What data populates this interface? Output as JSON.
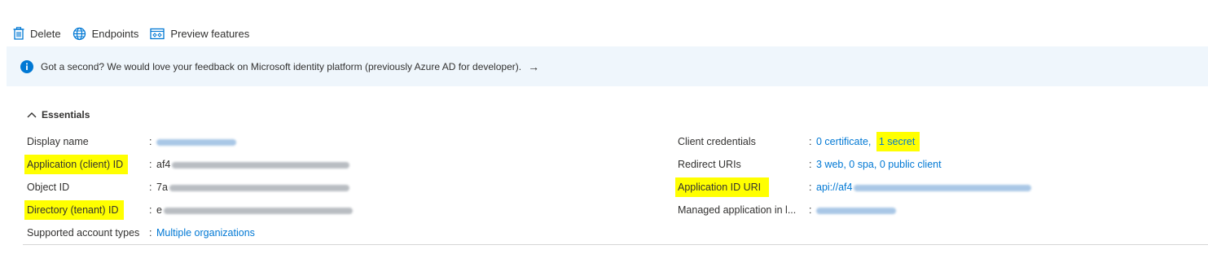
{
  "toolbar": {
    "delete_label": "Delete",
    "endpoints_label": "Endpoints",
    "preview_label": "Preview features"
  },
  "banner": {
    "text": "Got a second? We would love your feedback on Microsoft identity platform (previously Azure AD for developer).",
    "arrow": "→"
  },
  "essentials": {
    "header": "Essentials",
    "left": [
      {
        "label": "Display name",
        "value": ""
      },
      {
        "label": "Application (client) ID",
        "value": "af4"
      },
      {
        "label": "Object ID",
        "value": "7a"
      },
      {
        "label": "Directory (tenant) ID",
        "value": "e"
      },
      {
        "label": "Supported account types",
        "value": "Multiple organizations"
      }
    ],
    "right": [
      {
        "label": "Client credentials",
        "value_a": "0 certificate,",
        "value_b": "1 secret"
      },
      {
        "label": "Redirect URIs",
        "value": "3 web, 0 spa, 0 public client"
      },
      {
        "label": "Application ID URI",
        "value": "api://af4"
      },
      {
        "label": "Managed application in l...",
        "value": ""
      }
    ]
  },
  "colors": {
    "accent": "#0078d4",
    "banner_bg": "#eff6fc",
    "highlight": "#ffff00"
  }
}
